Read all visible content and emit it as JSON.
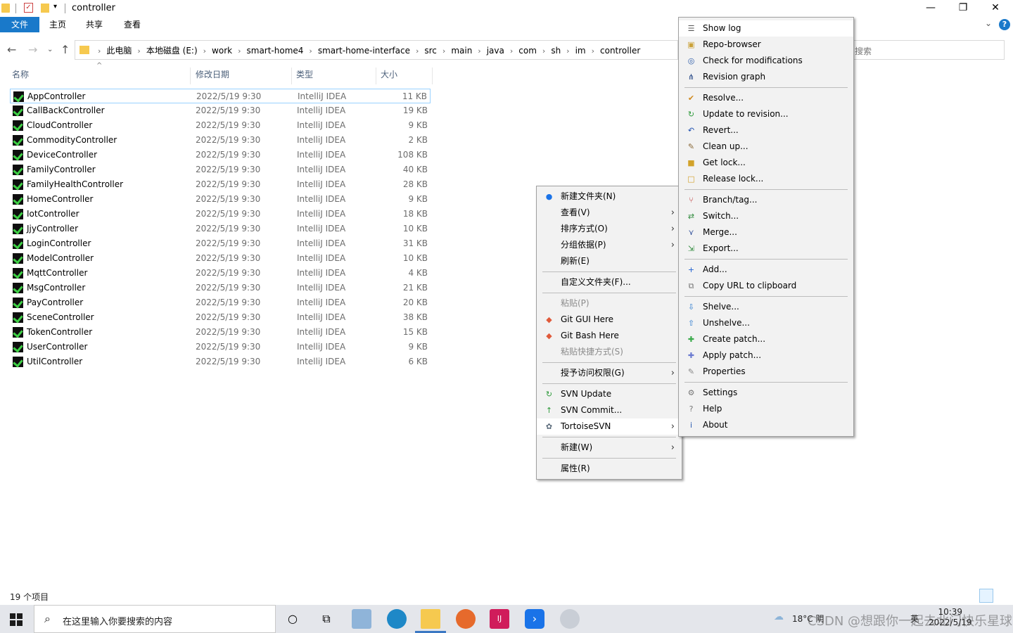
{
  "window": {
    "title": "controller",
    "minimize": "—",
    "maximize": "❐",
    "close": "✕"
  },
  "ribbon": {
    "tabs": [
      "文件",
      "主页",
      "共享",
      "查看"
    ],
    "help": "?"
  },
  "address": {
    "crumbs": [
      "此电脑",
      "本地磁盘 (E:)",
      "work",
      "smart-home4",
      "smart-home-interface",
      "src",
      "main",
      "java",
      "com",
      "sh",
      "im",
      "controller"
    ],
    "search_placeholder": "搜索"
  },
  "columns": {
    "name": "名称",
    "date": "修改日期",
    "type": "类型",
    "size": "大小"
  },
  "files": [
    {
      "name": "AppController",
      "date": "2022/5/19 9:30",
      "type": "IntelliJ IDEA",
      "size": "11 KB"
    },
    {
      "name": "CallBackController",
      "date": "2022/5/19 9:30",
      "type": "IntelliJ IDEA",
      "size": "19 KB"
    },
    {
      "name": "CloudController",
      "date": "2022/5/19 9:30",
      "type": "IntelliJ IDEA",
      "size": "9 KB"
    },
    {
      "name": "CommodityController",
      "date": "2022/5/19 9:30",
      "type": "IntelliJ IDEA",
      "size": "2 KB"
    },
    {
      "name": "DeviceController",
      "date": "2022/5/19 9:30",
      "type": "IntelliJ IDEA",
      "size": "108 KB"
    },
    {
      "name": "FamilyController",
      "date": "2022/5/19 9:30",
      "type": "IntelliJ IDEA",
      "size": "40 KB"
    },
    {
      "name": "FamilyHealthController",
      "date": "2022/5/19 9:30",
      "type": "IntelliJ IDEA",
      "size": "28 KB"
    },
    {
      "name": "HomeController",
      "date": "2022/5/19 9:30",
      "type": "IntelliJ IDEA",
      "size": "9 KB"
    },
    {
      "name": "IotController",
      "date": "2022/5/19 9:30",
      "type": "IntelliJ IDEA",
      "size": "18 KB"
    },
    {
      "name": "JjyController",
      "date": "2022/5/19 9:30",
      "type": "IntelliJ IDEA",
      "size": "10 KB"
    },
    {
      "name": "LoginController",
      "date": "2022/5/19 9:30",
      "type": "IntelliJ IDEA",
      "size": "31 KB"
    },
    {
      "name": "ModelController",
      "date": "2022/5/19 9:30",
      "type": "IntelliJ IDEA",
      "size": "10 KB"
    },
    {
      "name": "MqttController",
      "date": "2022/5/19 9:30",
      "type": "IntelliJ IDEA",
      "size": "4 KB"
    },
    {
      "name": "MsgController",
      "date": "2022/5/19 9:30",
      "type": "IntelliJ IDEA",
      "size": "21 KB"
    },
    {
      "name": "PayController",
      "date": "2022/5/19 9:30",
      "type": "IntelliJ IDEA",
      "size": "20 KB"
    },
    {
      "name": "SceneController",
      "date": "2022/5/19 9:30",
      "type": "IntelliJ IDEA",
      "size": "38 KB"
    },
    {
      "name": "TokenController",
      "date": "2022/5/19 9:30",
      "type": "IntelliJ IDEA",
      "size": "15 KB"
    },
    {
      "name": "UserController",
      "date": "2022/5/19 9:30",
      "type": "IntelliJ IDEA",
      "size": "9 KB"
    },
    {
      "name": "UtilController",
      "date": "2022/5/19 9:30",
      "type": "IntelliJ IDEA",
      "size": "6 KB"
    }
  ],
  "status": {
    "count": "19 个项目"
  },
  "context_menu": [
    {
      "label": "新建文件夹(N)",
      "icon": "new-folder-icon"
    },
    {
      "label": "查看(V)",
      "submenu": true
    },
    {
      "label": "排序方式(O)",
      "submenu": true
    },
    {
      "label": "分组依据(P)",
      "submenu": true
    },
    {
      "label": "刷新(E)"
    },
    {
      "sep": true
    },
    {
      "label": "自定义文件夹(F)..."
    },
    {
      "sep": true
    },
    {
      "label": "粘贴(P)",
      "disabled": true
    },
    {
      "label": "Git GUI Here",
      "icon": "git-icon"
    },
    {
      "label": "Git Bash Here",
      "icon": "git-icon"
    },
    {
      "label": "粘贴快捷方式(S)",
      "disabled": true
    },
    {
      "sep": true
    },
    {
      "label": "授予访问权限(G)",
      "submenu": true
    },
    {
      "sep": true
    },
    {
      "label": "SVN Update",
      "icon": "svn-update-icon"
    },
    {
      "label": "SVN Commit...",
      "icon": "svn-commit-icon"
    },
    {
      "label": "TortoiseSVN",
      "icon": "tortoise-icon",
      "submenu": true,
      "highlight": true
    },
    {
      "sep": true
    },
    {
      "label": "新建(W)",
      "submenu": true
    },
    {
      "sep": true
    },
    {
      "label": "属性(R)"
    }
  ],
  "svn_menu": [
    {
      "label": "Show log",
      "icon": "log-icon",
      "highlight": true
    },
    {
      "label": "Repo-browser",
      "icon": "repo-browser-icon"
    },
    {
      "label": "Check for modifications",
      "icon": "check-modifications-icon"
    },
    {
      "label": "Revision graph",
      "icon": "revision-graph-icon"
    },
    {
      "sep": true
    },
    {
      "label": "Resolve...",
      "icon": "resolve-icon"
    },
    {
      "label": "Update to revision...",
      "icon": "update-revision-icon"
    },
    {
      "label": "Revert...",
      "icon": "revert-icon"
    },
    {
      "label": "Clean up...",
      "icon": "cleanup-icon"
    },
    {
      "label": "Get lock...",
      "icon": "lock-icon"
    },
    {
      "label": "Release lock...",
      "icon": "unlock-icon"
    },
    {
      "sep": true
    },
    {
      "label": "Branch/tag...",
      "icon": "branch-icon"
    },
    {
      "label": "Switch...",
      "icon": "switch-icon"
    },
    {
      "label": "Merge...",
      "icon": "merge-icon"
    },
    {
      "label": "Export...",
      "icon": "export-icon"
    },
    {
      "sep": true
    },
    {
      "label": "Add...",
      "icon": "add-icon"
    },
    {
      "label": "Copy URL to clipboard",
      "icon": "copy-url-icon"
    },
    {
      "sep": true
    },
    {
      "label": "Shelve...",
      "icon": "shelve-icon"
    },
    {
      "label": "Unshelve...",
      "icon": "unshelve-icon"
    },
    {
      "label": "Create patch...",
      "icon": "create-patch-icon"
    },
    {
      "label": "Apply patch...",
      "icon": "apply-patch-icon"
    },
    {
      "label": "Properties",
      "icon": "properties-icon"
    },
    {
      "sep": true
    },
    {
      "label": "Settings",
      "icon": "settings-icon"
    },
    {
      "label": "Help",
      "icon": "help-icon"
    },
    {
      "label": "About",
      "icon": "about-icon"
    }
  ],
  "taskbar": {
    "search_placeholder": "在这里输入你要搜索的内容",
    "weather": "18°C 阴",
    "lang": "英",
    "time": "10:39",
    "date": "2022/5/19",
    "watermark": "CSDN @想跟你一起去北门快乐星球"
  },
  "colors": {
    "accent": "#1979ca",
    "selection_border": "#99d1ff",
    "menu_bg": "#f2f2f2"
  }
}
